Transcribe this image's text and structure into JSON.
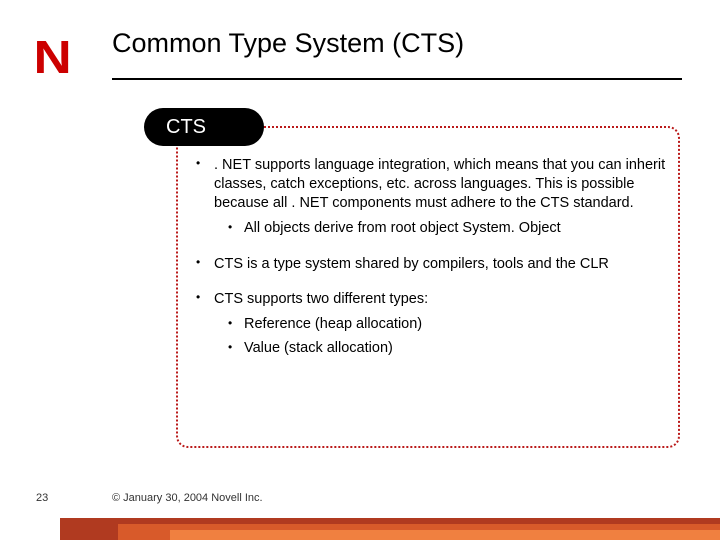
{
  "logo_text": "N",
  "title": "Common Type System (CTS)",
  "badge": "CTS",
  "bullets": [
    {
      "text": ". NET supports language integration, which means that you can inherit classes, catch exceptions, etc. across languages. This is possible because all . NET components must adhere to the CTS standard.",
      "sub": [
        "All objects derive from root object System. Object"
      ]
    },
    {
      "text": "CTS is a type system shared by compilers, tools and the CLR",
      "sub": []
    },
    {
      "text": "CTS supports two different types:",
      "sub": [
        "Reference (heap allocation)",
        "Value (stack allocation)"
      ]
    }
  ],
  "page_number": "23",
  "copyright": "© January 30, 2004 Novell Inc."
}
